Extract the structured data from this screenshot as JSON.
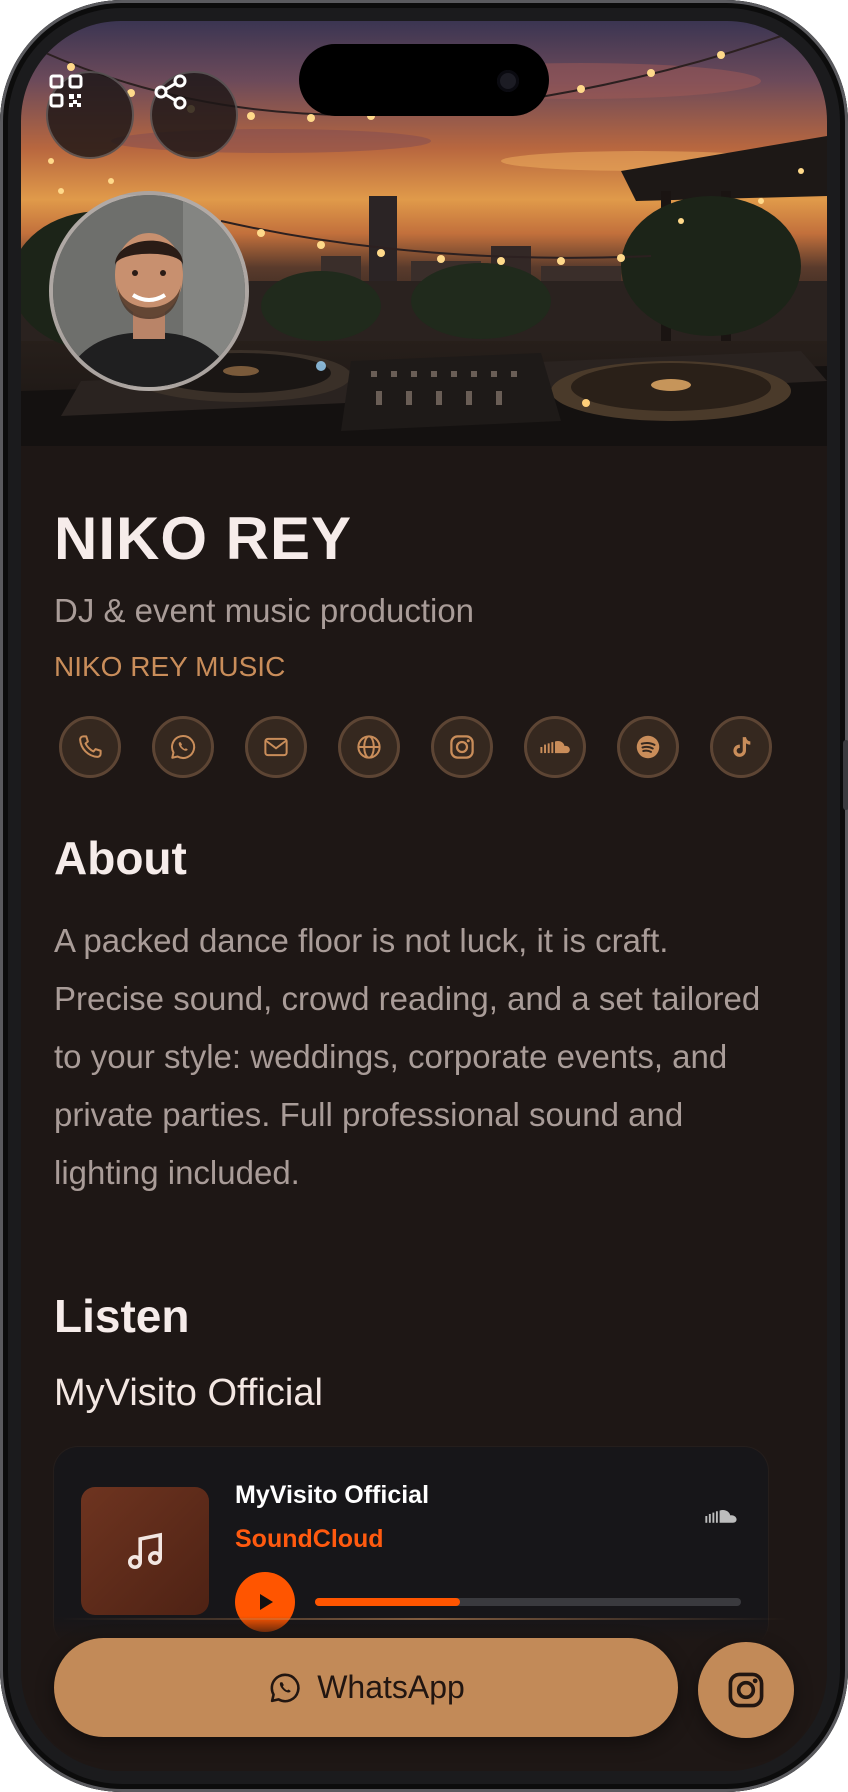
{
  "profile": {
    "name": "NIKO REY",
    "subtitle": "DJ & event music production",
    "brand": "NIKO REY MUSIC"
  },
  "header_actions": [
    {
      "icon": "qr-code-icon"
    },
    {
      "icon": "share-icon"
    }
  ],
  "social_icons": [
    {
      "icon": "phone-icon"
    },
    {
      "icon": "whatsapp-icon"
    },
    {
      "icon": "mail-icon"
    },
    {
      "icon": "globe-icon"
    },
    {
      "icon": "instagram-icon"
    },
    {
      "icon": "soundcloud-icon"
    },
    {
      "icon": "spotify-icon"
    },
    {
      "icon": "tiktok-icon"
    }
  ],
  "about": {
    "heading": "About",
    "text": "A packed dance floor is not luck, it is craft. Precise sound, crowd reading, and a set tailored to your style: weddings, corporate events, and private parties. Full professional sound and lighting included."
  },
  "listen": {
    "heading": "Listen",
    "playlist_title": "MyVisito Official",
    "player": {
      "track_title": "MyVisito Official",
      "source": "SoundCloud",
      "progress": 0.34
    }
  },
  "cta": {
    "whatsapp_label": "WhatsApp"
  },
  "colors": {
    "background": "#1e1715",
    "accent": "#c28a58",
    "soundcloud": "#ff5500",
    "text_primary": "#f6ecea",
    "text_secondary": "#a99c98"
  }
}
